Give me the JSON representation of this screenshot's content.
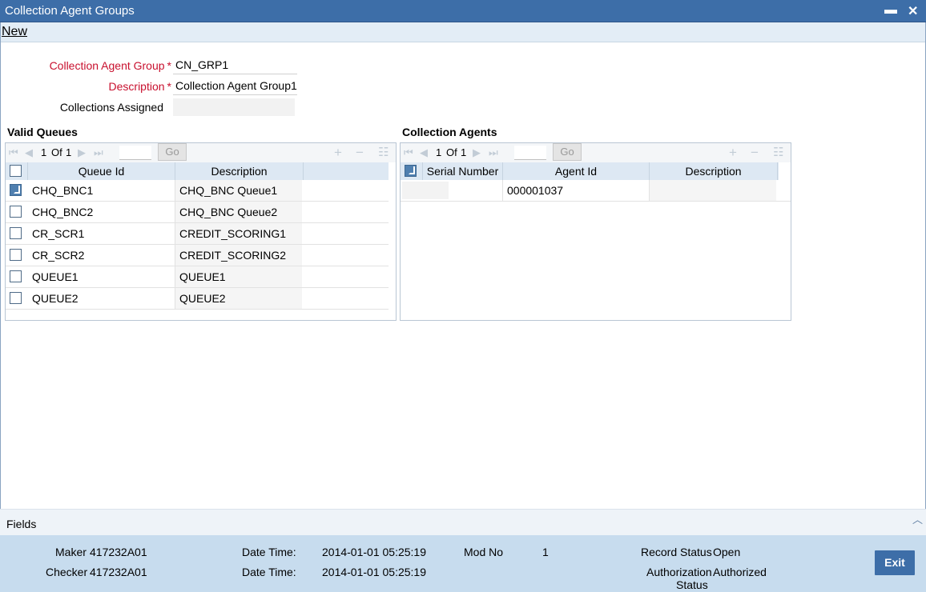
{
  "window": {
    "title": "Collection Agent Groups",
    "minimize": "▬",
    "close": "✕"
  },
  "menu": {
    "new_label": "New"
  },
  "form": {
    "group_label": "Collection Agent Group",
    "group_value": "CN_GRP1",
    "description_label": "Description",
    "description_value": "Collection Agent Group1",
    "assigned_label": "Collections Assigned",
    "assigned_value": "",
    "required_mark": "*"
  },
  "queues": {
    "title": "Valid Queues",
    "pager": {
      "current": "1",
      "of": "Of",
      "total": "1",
      "go": "Go"
    },
    "headers": [
      "Queue Id",
      "Description"
    ],
    "rows": [
      {
        "checked": true,
        "id": "CHQ_BNC1",
        "desc": "CHQ_BNC Queue1"
      },
      {
        "checked": false,
        "id": "CHQ_BNC2",
        "desc": "CHQ_BNC Queue2"
      },
      {
        "checked": false,
        "id": "CR_SCR1",
        "desc": "CREDIT_SCORING1"
      },
      {
        "checked": false,
        "id": "CR_SCR2",
        "desc": "CREDIT_SCORING2"
      },
      {
        "checked": false,
        "id": "QUEUE1",
        "desc": "QUEUE1"
      },
      {
        "checked": false,
        "id": "QUEUE2",
        "desc": "QUEUE2"
      }
    ]
  },
  "agents": {
    "title": "Collection Agents",
    "pager": {
      "current": "1",
      "of": "Of",
      "total": "1",
      "go": "Go"
    },
    "headers": [
      "Serial Number",
      "Agent Id",
      "Description"
    ],
    "rows": [
      {
        "checked": true,
        "serial": "",
        "agent": "000001037",
        "desc": ""
      }
    ]
  },
  "fields_label": "Fields",
  "footer": {
    "maker_label": "Maker",
    "maker_value": "417232A01",
    "checker_label": "Checker",
    "checker_value": "417232A01",
    "dt_label": "Date Time:",
    "maker_dt": "2014-01-01 05:25:19",
    "checker_dt": "2014-01-01 05:25:19",
    "modno_label": "Mod No",
    "modno_value": "1",
    "record_status_label": "Record Status",
    "record_status_value": "Open",
    "auth_status_label_1": "Authorization",
    "auth_status_label_2": "Status",
    "auth_status_value": "Authorized",
    "exit_label": "Exit"
  }
}
